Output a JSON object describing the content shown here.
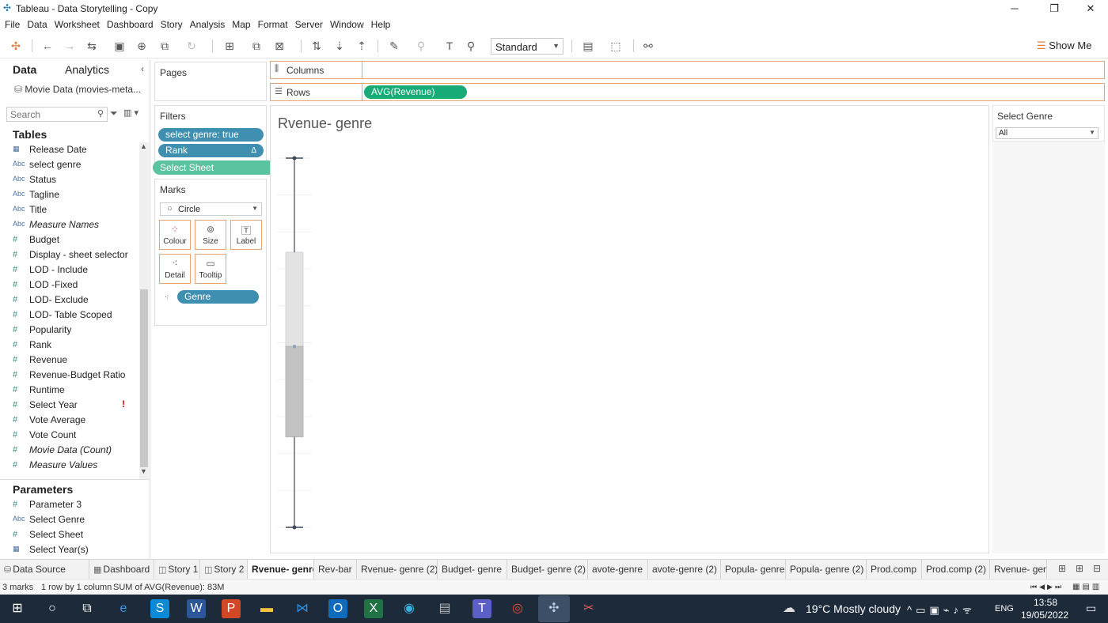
{
  "window": {
    "title": "Tableau - Data Storytelling - Copy",
    "minimize": "─",
    "restore": "❐",
    "close": "✕"
  },
  "menu": [
    "File",
    "Data",
    "Worksheet",
    "Dashboard",
    "Story",
    "Analysis",
    "Map",
    "Format",
    "Server",
    "Window",
    "Help"
  ],
  "toolbar": {
    "fit_select": "Standard",
    "show_me": "Show Me"
  },
  "data_pane": {
    "tab_data": "Data",
    "tab_analytics": "Analytics",
    "datasource": "Movie Data (movies-meta...",
    "search_placeholder": "Search",
    "tables_header": "Tables",
    "fields": [
      {
        "label": "Release Date",
        "icon": "date",
        "italic": false
      },
      {
        "label": "select genre",
        "icon": "abc",
        "italic": false
      },
      {
        "label": "Status",
        "icon": "abc",
        "italic": false
      },
      {
        "label": "Tagline",
        "icon": "abc",
        "italic": false
      },
      {
        "label": "Title",
        "icon": "abc",
        "italic": false
      },
      {
        "label": "Measure Names",
        "icon": "abc",
        "italic": true
      },
      {
        "label": "Budget",
        "icon": "num",
        "italic": false
      },
      {
        "label": "Display - sheet selector",
        "icon": "num",
        "italic": false
      },
      {
        "label": "LOD - Include",
        "icon": "num",
        "italic": false
      },
      {
        "label": "LOD -Fixed",
        "icon": "num",
        "italic": false
      },
      {
        "label": "LOD- Exclude",
        "icon": "num",
        "italic": false
      },
      {
        "label": "LOD- Table Scoped",
        "icon": "num",
        "italic": false
      },
      {
        "label": "Popularity",
        "icon": "num",
        "italic": false
      },
      {
        "label": "Rank",
        "icon": "num",
        "italic": false
      },
      {
        "label": "Revenue",
        "icon": "num",
        "italic": false
      },
      {
        "label": "Revenue-Budget Ratio",
        "icon": "num",
        "italic": false
      },
      {
        "label": "Runtime",
        "icon": "num",
        "italic": false
      },
      {
        "label": "Select Year",
        "icon": "num",
        "italic": false,
        "warn": "!"
      },
      {
        "label": "Vote Average",
        "icon": "num",
        "italic": false
      },
      {
        "label": "Vote Count",
        "icon": "num",
        "italic": false
      },
      {
        "label": "Movie Data (Count)",
        "icon": "num",
        "italic": true
      },
      {
        "label": "Measure Values",
        "icon": "num",
        "italic": true
      }
    ],
    "parameters_header": "Parameters",
    "parameters": [
      {
        "label": "Parameter 3",
        "icon": "num"
      },
      {
        "label": "Select Genre",
        "icon": "abc"
      },
      {
        "label": "Select Sheet",
        "icon": "num"
      },
      {
        "label": "Select Year(s)",
        "icon": "date"
      }
    ]
  },
  "pages": {
    "title": "Pages"
  },
  "filters": {
    "title": "Filters",
    "pills": [
      "select genre: true",
      "Rank"
    ],
    "rank_delta": "Δ",
    "dragging_pill": "Select Sheet"
  },
  "marks": {
    "title": "Marks",
    "type": "Circle",
    "buttons": [
      "Colour",
      "Size",
      "Label",
      "Detail",
      "Tooltip"
    ],
    "detail_pill": "Genre"
  },
  "shelves": {
    "columns_label": "Columns",
    "rows_label": "Rows",
    "rows_pill": "AVG(Revenue)"
  },
  "view": {
    "sheet_title": "Rvenue- genre"
  },
  "chart_data": {
    "type": "box",
    "title": "Rvenue- genre",
    "xlabel": "",
    "ylabel": "",
    "box": {
      "whisker_high": 1.0,
      "q3": 0.745,
      "median": 0.49,
      "q1": 0.245,
      "whisker_low": 0.0
    },
    "colors": {
      "upper": "#e3e3e3",
      "lower": "#c3c3c3",
      "line": "#3d4a5c"
    }
  },
  "right_filter": {
    "title": "Select Genre",
    "value": "All"
  },
  "tabs": [
    {
      "label": "Data Source",
      "icon": "⛁",
      "active": false
    },
    {
      "label": "Dashboard",
      "icon": "▦",
      "active": false
    },
    {
      "label": "Story 1",
      "icon": "◫",
      "active": false
    },
    {
      "label": "Story 2",
      "icon": "◫",
      "active": false
    },
    {
      "label": "Rvenue- genre",
      "icon": "",
      "active": true
    },
    {
      "label": "Rev-bar",
      "icon": "",
      "active": false
    },
    {
      "label": "Rvenue- genre (2)",
      "icon": "",
      "active": false
    },
    {
      "label": "Budget- genre",
      "icon": "",
      "active": false
    },
    {
      "label": "Budget- genre (2)",
      "icon": "",
      "active": false
    },
    {
      "label": "avote-genre",
      "icon": "",
      "active": false
    },
    {
      "label": "avote-genre (2)",
      "icon": "",
      "active": false
    },
    {
      "label": "Popula- genre",
      "icon": "",
      "active": false
    },
    {
      "label": "Popula- genre (2)",
      "icon": "",
      "active": false
    },
    {
      "label": "Prod.comp",
      "icon": "",
      "active": false
    },
    {
      "label": "Prod.comp (2)",
      "icon": "",
      "active": false
    },
    {
      "label": "Rvenue- genr",
      "icon": "",
      "active": false
    }
  ],
  "status": {
    "marks": "3 marks",
    "rows_cols": "1 row by 1 column",
    "sum": "SUM of AVG(Revenue): 83M"
  },
  "taskbar": {
    "weather": "19°C  Mostly cloudy",
    "lang": "ENG",
    "time": "13:58",
    "date": "19/05/2022"
  }
}
